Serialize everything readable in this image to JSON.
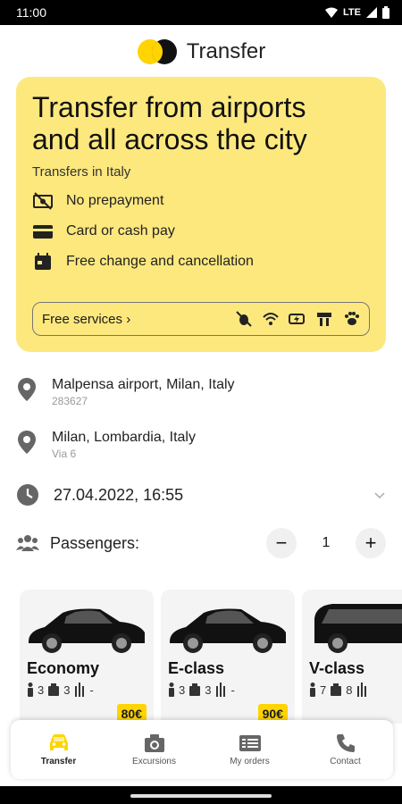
{
  "status": {
    "time": "11:00",
    "network": "LTE"
  },
  "app": {
    "title": "Transfer"
  },
  "hero": {
    "title_line1": "Transfer from airports",
    "title_line2": "and all across the city",
    "subtitle": "Transfers in Italy",
    "features": [
      {
        "icon": "no-money-icon",
        "label": "No prepayment"
      },
      {
        "icon": "card-icon",
        "label": "Card or cash pay"
      },
      {
        "icon": "calendar-icon",
        "label": "Free change and cancellation"
      }
    ],
    "free_services_label": "Free services ›"
  },
  "trip": {
    "from_main": "Malpensa airport, Milan, Italy",
    "from_sub": "283627",
    "to_main": "Milan, Lombardia, Italy",
    "to_sub": "Via 6",
    "datetime": "27.04.2022, 16:55"
  },
  "passengers": {
    "label": "Passengers:",
    "count": "1",
    "minus": "−",
    "plus": "+"
  },
  "cars": [
    {
      "name": "Economy",
      "people": "3",
      "bags": "3",
      "extra": "-",
      "price": "80€"
    },
    {
      "name": "E-class",
      "people": "3",
      "bags": "3",
      "extra": "-",
      "price": "90€"
    },
    {
      "name": "V-class",
      "people": "7",
      "bags": "8",
      "extra": "",
      "price": ""
    }
  ],
  "nav": [
    {
      "label": "Transfer",
      "icon": "car-icon",
      "active": true
    },
    {
      "label": "Excursions",
      "icon": "camera-icon"
    },
    {
      "label": "My orders",
      "icon": "orders-icon"
    },
    {
      "label": "Contact",
      "icon": "phone-icon"
    }
  ],
  "colors": {
    "accent": "#ffd400",
    "hero_bg": "#fde87e"
  }
}
